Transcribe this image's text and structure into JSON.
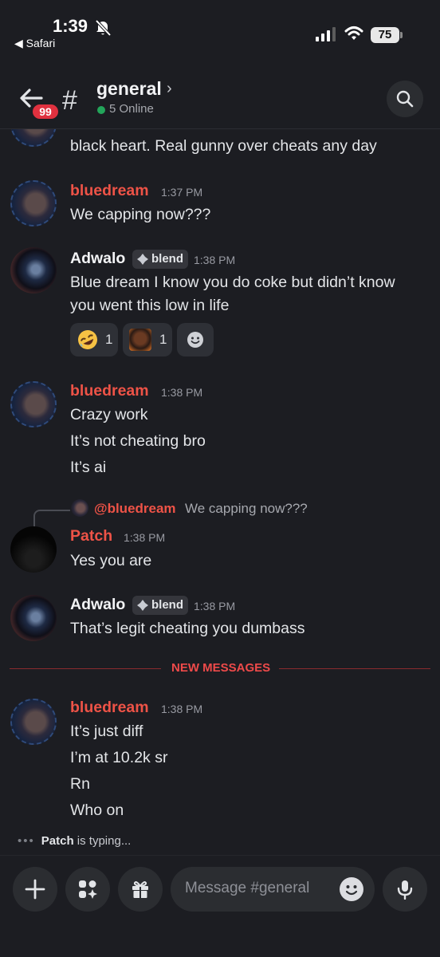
{
  "status_bar": {
    "time": "1:39",
    "back_app": "◀ Safari",
    "battery": "75"
  },
  "header": {
    "mention_count": "99",
    "channel_name": "general",
    "online_text": "5 Online"
  },
  "messages": {
    "partial_top": "black heart. Real gunny over cheats any day",
    "m1": {
      "author": "bluedream",
      "time": "1:37 PM",
      "lines": [
        "We capping now???"
      ]
    },
    "m2": {
      "author": "Adwalo",
      "role": "blend",
      "time": "1:38 PM",
      "lines": [
        "Blue dream I know you do coke but didn’t know",
        "you went this low in life"
      ],
      "reactions": [
        {
          "emoji": "rolling-on-floor-laughing",
          "count": "1"
        },
        {
          "emoji": "custom-image",
          "count": "1"
        }
      ]
    },
    "m3": {
      "author": "bluedream",
      "time": "1:38 PM",
      "lines": [
        "Crazy work",
        "It’s not cheating bro",
        "It’s ai"
      ]
    },
    "m4": {
      "reply_author": "@bluedream",
      "reply_text": "We capping now???",
      "author": "Patch",
      "time": "1:38 PM",
      "lines": [
        "Yes you are"
      ]
    },
    "m5": {
      "author": "Adwalo",
      "role": "blend",
      "time": "1:38 PM",
      "lines": [
        "That’s legit cheating you dumbass"
      ]
    },
    "new_messages_label": "NEW MESSAGES",
    "m6": {
      "author": "bluedream",
      "time": "1:38 PM",
      "lines": [
        "It’s just diff",
        "I’m at 10.2k sr",
        "Rn",
        "Who on"
      ]
    }
  },
  "typing": {
    "dots": "•••",
    "who": "Patch",
    "suffix": " is typing..."
  },
  "composer": {
    "placeholder": "Message #general"
  },
  "colors": {
    "background": "#1c1d22",
    "username_red": "#ee5347",
    "new_messages_red": "#ee4a4a",
    "online_green": "#23a55a",
    "mention_badge": "#e0313f"
  }
}
